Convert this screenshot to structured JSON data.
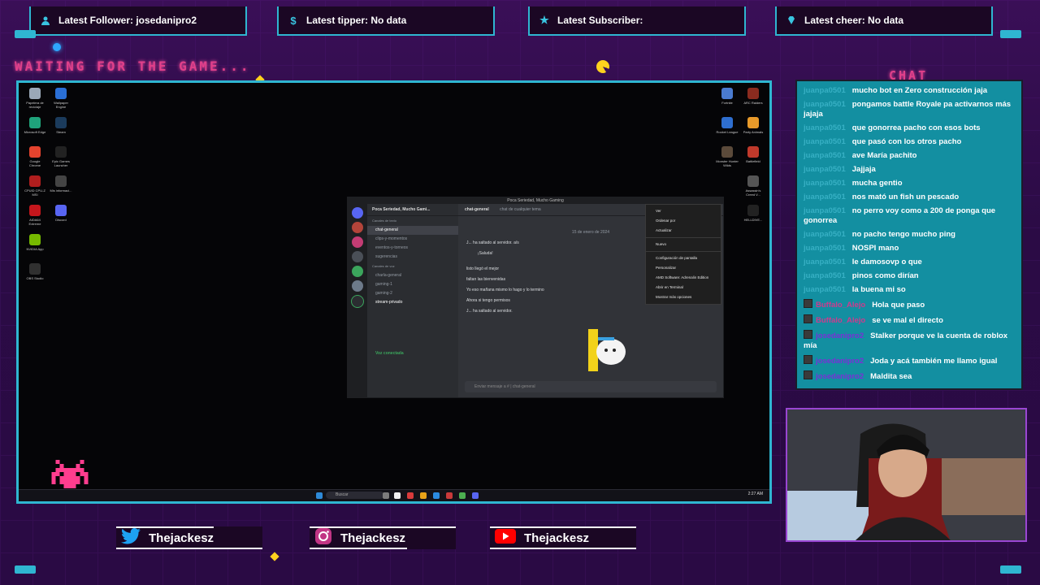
{
  "alerts": [
    {
      "icon": "person-icon",
      "label": "Latest Follower: josedanipro2"
    },
    {
      "icon": "dollar-icon",
      "label": "Latest tipper: No data"
    },
    {
      "icon": "star-icon",
      "label": "Latest Subscriber:"
    },
    {
      "icon": "diamond-icon",
      "label": "Latest cheer: No data"
    }
  ],
  "waiting_text": "WAITING FOR THE GAME...",
  "chat_title": "CHAT",
  "discord": {
    "window_title": "Poca Seriedad, Mucho Gaming",
    "server_name": "Poca Seriedad, Mucho Gami...",
    "text_category": "Canales de texto",
    "channels": [
      "chat-general",
      "clips-y-momentos",
      "eventos-y-torneos",
      "sugerencias"
    ],
    "voice_category": "Canales de voz",
    "voice_channels": [
      "charla-general",
      "gaming-1",
      "gaming-2",
      "stream-privado"
    ],
    "voice_connected": "Voz conectada",
    "header_channel": "chat-general",
    "header_topic": "chat de cualquier tema",
    "date_divider": "15 de enero de 2024",
    "messages": [
      "J... ha saltado al servidor. a/s",
      "¡Saluda!",
      "listo llegó el mejor",
      "faltan las bienvenidas",
      "Yo eso mañana mismo lo hago y lo termino",
      "Ahora si tengo permisos",
      "J... ha saltado al servidor."
    ],
    "input_placeholder": "Enviar mensaje a # | chat-general",
    "context_menu": [
      "Ver",
      "Ordenar por",
      "Actualizar",
      "Nuevo",
      "Configuración de pantalla",
      "Personalizar",
      "AMD Software: Adrenalin Edition",
      "Abrir en Terminal",
      "Mostrar más opciones"
    ]
  },
  "taskbar": {
    "search_label": "Buscar",
    "clock": "2:27 AM"
  },
  "desktop_icons_left": [
    {
      "label": "Papelera de reciclaje",
      "color": "#9aa8b8"
    },
    {
      "label": "Wallpaper Engine",
      "color": "#2a6fd6"
    },
    {
      "label": "Microsoft Edge",
      "color": "#1fa37b"
    },
    {
      "label": "Steam",
      "color": "#1b3b5c"
    },
    {
      "label": "Google Chrome",
      "color": "#e5432e"
    },
    {
      "label": "Epic Games Launcher",
      "color": "#222222"
    },
    {
      "label": "CPUID CPU-Z MSI",
      "color": "#b01e1e"
    },
    {
      "label": "Mis informaci...",
      "color": "#444444"
    },
    {
      "label": "AIDA64 Extreme",
      "color": "#c4161c"
    },
    {
      "label": "Discord",
      "color": "#5865f2"
    },
    {
      "label": "NVIDIA App",
      "color": "#76b900"
    },
    {
      "label": "",
      "color": "transparent"
    },
    {
      "label": "OBS Studio",
      "color": "#303030"
    }
  ],
  "desktop_icons_right": [
    {
      "label": "Fortnite",
      "color": "#4a7bd0"
    },
    {
      "label": "ARC Raiders",
      "color": "#8a2b1f"
    },
    {
      "label": "Rocket League",
      "color": "#2e6ecf"
    },
    {
      "label": "Party Animals",
      "color": "#e89a2a"
    },
    {
      "label": "Monster Hunter Wilds",
      "color": "#5b4a3a"
    },
    {
      "label": "Battlefield",
      "color": "#c0392b"
    },
    {
      "label": "",
      "color": "transparent"
    },
    {
      "label": "Assassin's Creed V...",
      "color": "#555555"
    },
    {
      "label": "",
      "color": "transparent"
    },
    {
      "label": "HELLDIVE...",
      "color": "#222222"
    }
  ],
  "chat": [
    {
      "user": "juanpa0501",
      "text": "mucho bot en Zero construcción jaja",
      "color": "#37b0c4",
      "badge": false
    },
    {
      "user": "juanpa0501",
      "text": "pongamos battle Royale pa activarnos más jajaja",
      "color": "#37b0c4",
      "badge": false
    },
    {
      "user": "juanpa0501",
      "text": "que gonorrea pacho con esos bots",
      "color": "#37b0c4",
      "badge": false
    },
    {
      "user": "juanpa0501",
      "text": "que pasó con los otros pacho",
      "color": "#37b0c4",
      "badge": false
    },
    {
      "user": "juanpa0501",
      "text": "ave María pachito",
      "color": "#37b0c4",
      "badge": false
    },
    {
      "user": "juanpa0501",
      "text": "Jajjaja",
      "color": "#37b0c4",
      "badge": false
    },
    {
      "user": "juanpa0501",
      "text": "mucha gentio",
      "color": "#37b0c4",
      "badge": false
    },
    {
      "user": "juanpa0501",
      "text": "nos mató un fish un pescado",
      "color": "#37b0c4",
      "badge": false
    },
    {
      "user": "juanpa0501",
      "text": "no perro voy como a 200 de ponga que gonorrea",
      "color": "#37b0c4",
      "badge": false
    },
    {
      "user": "juanpa0501",
      "text": "no pacho tengo mucho ping",
      "color": "#37b0c4",
      "badge": false
    },
    {
      "user": "juanpa0501",
      "text": "NOSPI mano",
      "color": "#37b0c4",
      "badge": false
    },
    {
      "user": "juanpa0501",
      "text": "le damosovp o que",
      "color": "#37b0c4",
      "badge": false
    },
    {
      "user": "juanpa0501",
      "text": "pinos como dirían",
      "color": "#37b0c4",
      "badge": false
    },
    {
      "user": "juanpa0501",
      "text": "la buena mi so",
      "color": "#37b0c4",
      "badge": false
    },
    {
      "user": "Buffalo_Alejo",
      "text": "Hola que paso",
      "color": "#cf3a8e",
      "badge": true
    },
    {
      "user": "Buffalo_Alejo",
      "text": "se ve mal el directo",
      "color": "#cf3a8e",
      "badge": true
    },
    {
      "user": "josedanipro2",
      "text": "Stalker porque ve la cuenta de roblox mía",
      "color": "#7b2fd6",
      "badge": true
    },
    {
      "user": "josedanipro2",
      "text": "Joda y acá también me llamo igual",
      "color": "#7b2fd6",
      "badge": true
    },
    {
      "user": "josedanipro2",
      "text": "Maldita sea",
      "color": "#7b2fd6",
      "badge": true
    }
  ],
  "socials": [
    {
      "icon": "twitter-icon",
      "name": "Thejackesz",
      "color": "#1da1f2"
    },
    {
      "icon": "instagram-icon",
      "name": "Thejackesz",
      "color": "#c13584"
    },
    {
      "icon": "youtube-icon",
      "name": "Thejackesz",
      "color": "#ff0000"
    }
  ]
}
